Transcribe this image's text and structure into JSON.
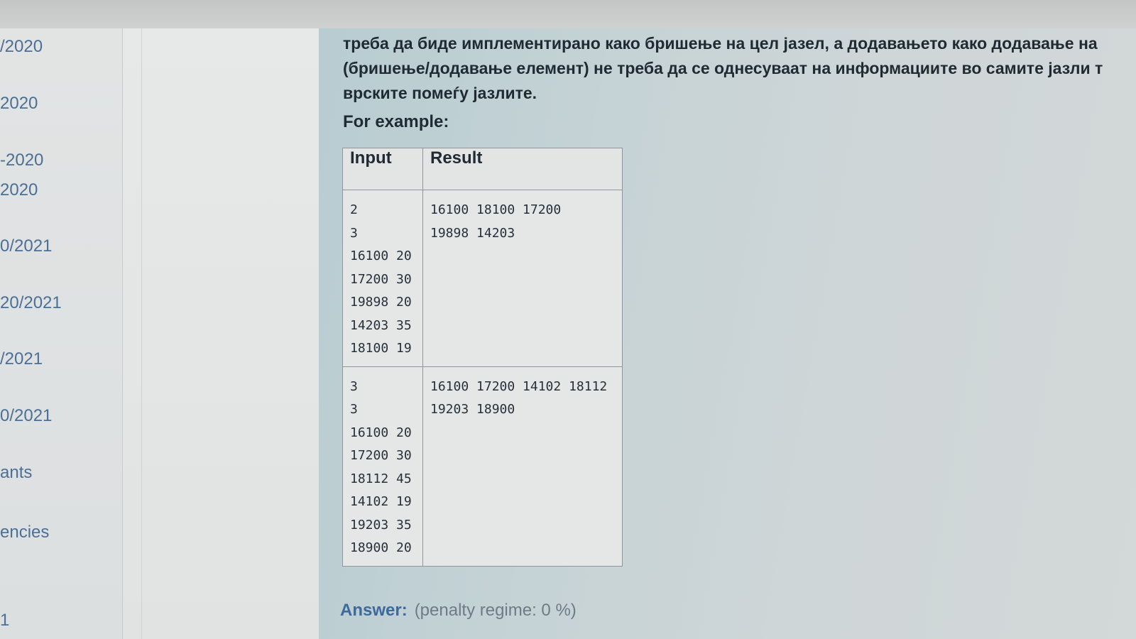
{
  "sidebar": {
    "items": [
      {
        "label": "/2020"
      },
      {
        "label": "2020"
      },
      {
        "label": "-2020"
      },
      {
        "label": "2020"
      },
      {
        "label": "0/2021"
      },
      {
        "label": "20/2021"
      },
      {
        "label": "/2021"
      },
      {
        "label": "0/2021"
      },
      {
        "label": "ants"
      },
      {
        "label": "encies"
      },
      {
        "label": "1"
      }
    ]
  },
  "question": {
    "text_lines": [
      "треба да биде имплементирано како бришење на цел јазел, а додавањето како додавање на",
      "(бришење/додавање елемент) не треба да се однесуваат на информациите во самите јазли т",
      "врските помеѓу јазлите."
    ],
    "for_example": "For example:"
  },
  "examples": {
    "headers": {
      "input": "Input",
      "result": "Result"
    },
    "rows": [
      {
        "input": [
          "2",
          "3",
          "16100 20",
          "17200 30",
          "19898 20",
          "14203 35",
          "18100 19"
        ],
        "result": [
          "16100 18100 17200",
          "19898 14203"
        ]
      },
      {
        "input": [
          "3",
          "3",
          "16100 20",
          "17200 30",
          "18112 45",
          "14102 19",
          "19203 35",
          "18900 20"
        ],
        "result": [
          "16100 17200 14102 18112",
          "19203 18900"
        ]
      }
    ]
  },
  "answer": {
    "label": "Answer:",
    "penalty": "(penalty regime: 0 %)"
  }
}
